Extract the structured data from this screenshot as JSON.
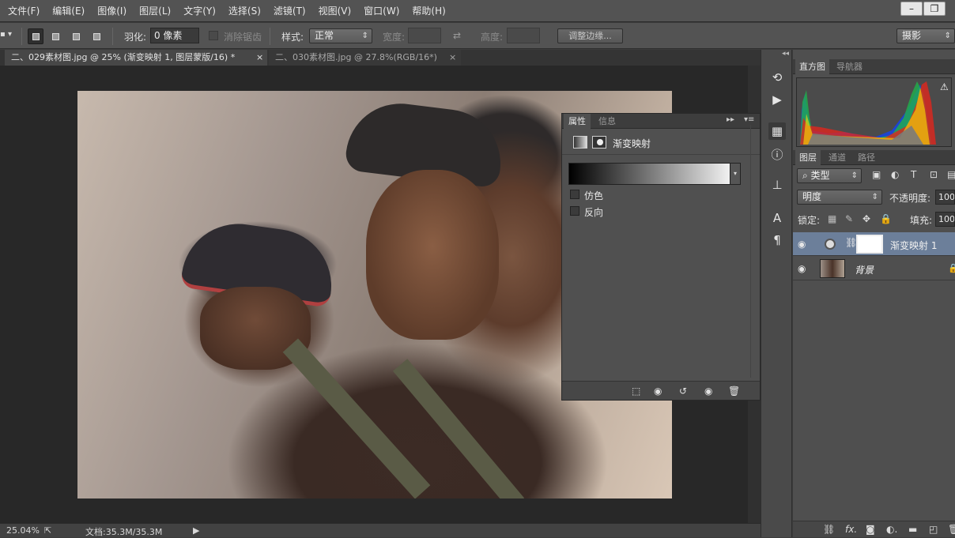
{
  "menu": [
    "文件(F)",
    "编辑(E)",
    "图像(I)",
    "图层(L)",
    "文字(Y)",
    "选择(S)",
    "滤镜(T)",
    "视图(V)",
    "窗口(W)",
    "帮助(H)"
  ],
  "window_buttons": {
    "minimize": "–",
    "restore": "❐"
  },
  "options": {
    "feather_label": "羽化:",
    "feather_value": "0 像素",
    "antialias_label": "消除锯齿",
    "style_label": "样式:",
    "style_value": "正常",
    "width_label": "宽度:",
    "height_label": "高度:",
    "refine_edge_label": "调整边缘...",
    "workspace_value": "摄影"
  },
  "doc_tabs": [
    {
      "title": "二、029素材图.jpg @ 25% (渐变映射 1, 图层蒙版/16) *",
      "close": "×"
    },
    {
      "title": "二、030素材图.jpg @ 27.8%(RGB/16*)",
      "close": "×"
    }
  ],
  "properties_panel": {
    "tabs": [
      "属性",
      "信息"
    ],
    "adjustment_name": "渐变映射",
    "dither_label": "仿色",
    "reverse_label": "反向",
    "dither_checked": false,
    "reverse_checked": false
  },
  "navigator_tabs": [
    "直方图",
    "导航器"
  ],
  "histogram": {
    "warning_icon": "⚠"
  },
  "layers_panel": {
    "tabs": [
      "图层",
      "通道",
      "路径"
    ],
    "filter_kind": "类型",
    "blend_mode": "明度",
    "opacity_label": "不透明度:",
    "opacity_value": "100%",
    "lock_label": "锁定:",
    "fill_label": "填充:",
    "fill_value": "100%",
    "layers": [
      {
        "name": "渐变映射 1",
        "visible": true,
        "selected": true
      },
      {
        "name": "背景",
        "visible": true,
        "selected": false
      }
    ]
  },
  "status": {
    "zoom": "25.04%",
    "doc_size": "文档:35.3M/35.3M"
  },
  "colors": {
    "chrome": "#535353",
    "panel": "#4f4f4f",
    "selected_layer": "#6c7f9a",
    "canvas_bg": "#282828"
  }
}
